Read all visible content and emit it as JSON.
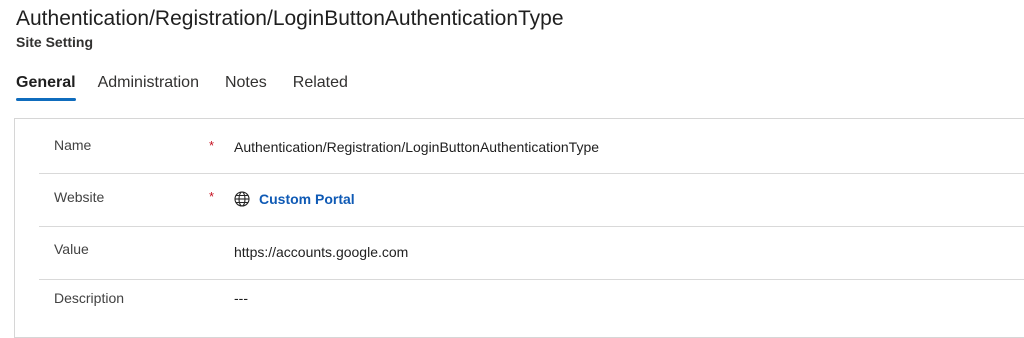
{
  "record": {
    "title": "Authentication/Registration/LoginButtonAuthenticationType",
    "subtitle": "Site Setting"
  },
  "tabs": [
    {
      "label": "General",
      "active": true
    },
    {
      "label": "Administration",
      "active": false
    },
    {
      "label": "Notes",
      "active": false
    },
    {
      "label": "Related",
      "active": false
    }
  ],
  "form": {
    "required_marker": "*",
    "fields": {
      "name": {
        "label": "Name",
        "value": "Authentication/Registration/LoginButtonAuthenticationType",
        "required": true
      },
      "website": {
        "label": "Website",
        "value": "Custom Portal",
        "required": true,
        "icon": "globe-icon"
      },
      "value": {
        "label": "Value",
        "value": "https://accounts.google.com",
        "required": false
      },
      "description": {
        "label": "Description",
        "value": "---",
        "required": false
      }
    }
  },
  "colors": {
    "accent": "#0f6cbd",
    "link": "#0f5ab5",
    "required": "#c50f1f"
  }
}
